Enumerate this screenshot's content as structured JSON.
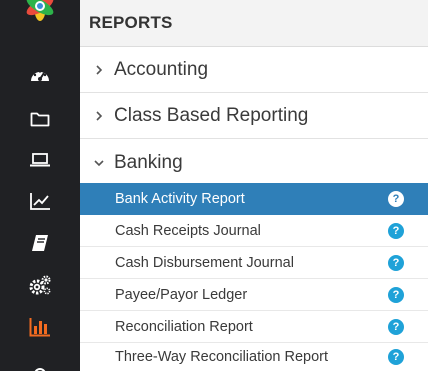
{
  "sidebar": {
    "icons": [
      "app-logo-icon",
      "dashboard-icon",
      "folder-icon",
      "laptop-icon",
      "trend-chart-icon",
      "book-icon",
      "settings-gears-icon",
      "reports-bar-chart-icon",
      "more-icon"
    ],
    "active_icon": "reports-bar-chart-icon",
    "active_color": "#f26b21"
  },
  "panel": {
    "title": "REPORTS",
    "sections": [
      {
        "label": "Accounting",
        "expanded": false
      },
      {
        "label": "Class Based Reporting",
        "expanded": false
      },
      {
        "label": "Banking",
        "expanded": true
      }
    ],
    "banking_items": [
      {
        "label": "Bank Activity Report",
        "help": "?",
        "selected": true
      },
      {
        "label": "Cash Receipts Journal",
        "help": "?",
        "selected": false
      },
      {
        "label": "Cash Disbursement Journal",
        "help": "?",
        "selected": false
      },
      {
        "label": "Payee/Payor Ledger",
        "help": "?",
        "selected": false
      },
      {
        "label": "Reconciliation Report",
        "help": "?",
        "selected": false
      },
      {
        "label": "Three-Way Reconciliation Report",
        "help": "?",
        "selected": false
      }
    ]
  },
  "colors": {
    "rail_bg": "#202124",
    "selected_bg": "#2f7fb8",
    "help_icon": "#1fa2d8"
  }
}
